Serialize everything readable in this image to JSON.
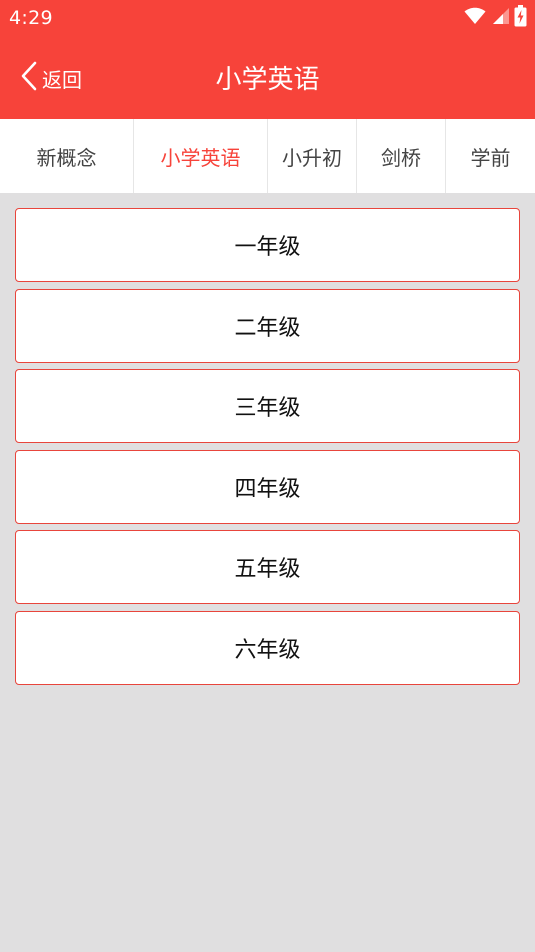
{
  "status_bar": {
    "time": "4:29",
    "icons": [
      "wifi-icon",
      "cellular-signal-icon",
      "battery-charging-icon"
    ]
  },
  "app_bar": {
    "back_label": "返回",
    "title": "小学英语",
    "background_color": "#f7433a"
  },
  "tabs": [
    {
      "label": "新概念",
      "active": false
    },
    {
      "label": "小学英语",
      "active": true
    },
    {
      "label": "小升初",
      "active": false
    },
    {
      "label": "剑桥",
      "active": false
    },
    {
      "label": "学前",
      "active": false
    }
  ],
  "grades": [
    {
      "label": "一年级"
    },
    {
      "label": "二年级"
    },
    {
      "label": "三年级"
    },
    {
      "label": "四年级"
    },
    {
      "label": "五年级"
    },
    {
      "label": "六年级"
    }
  ]
}
